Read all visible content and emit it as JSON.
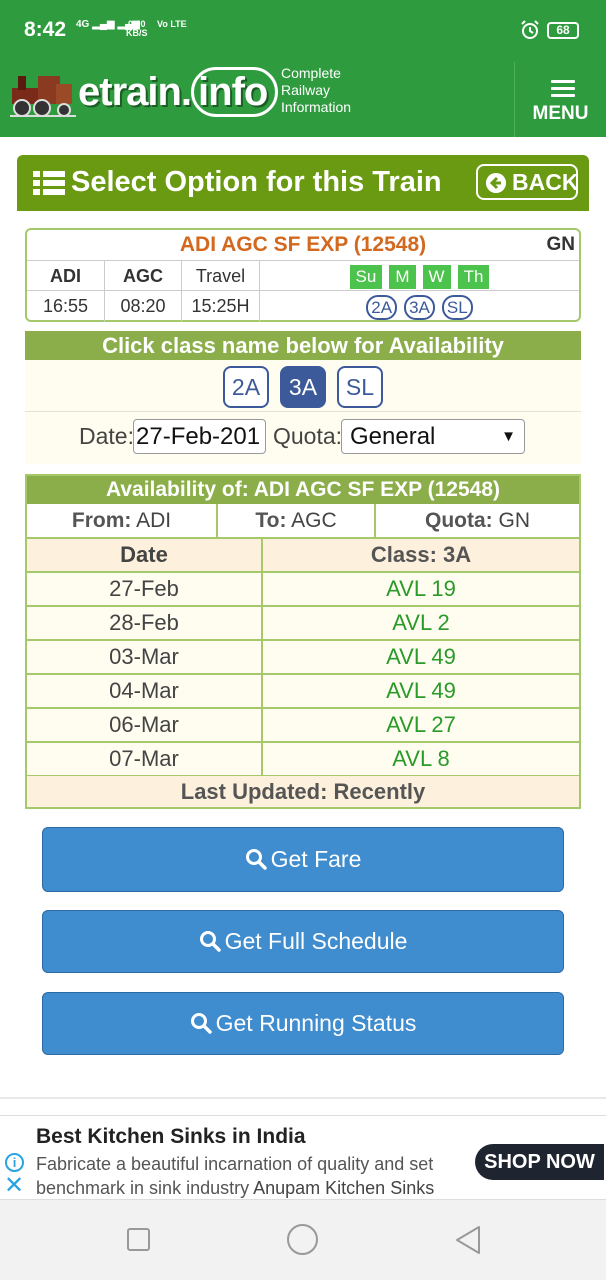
{
  "status_bar": {
    "time": "8:42",
    "network": "4G",
    "speed_value": "0.00",
    "speed_unit": "KB/S",
    "volte": "Vo LTE",
    "battery": "68"
  },
  "header": {
    "logo_part1": "etrain.",
    "logo_part2": "info",
    "tagline_1": "Complete",
    "tagline_2": "Railway",
    "tagline_3": "Information",
    "menu_label": "MENU"
  },
  "panel": {
    "title": "Select Option for this Train",
    "back_label": "BACK"
  },
  "train": {
    "name": "ADI AGC SF EXP (12548)",
    "quota_code": "GN",
    "from_code": "ADI",
    "to_code": "AGC",
    "travel_label": "Travel",
    "departure": "16:55",
    "arrival": "08:20",
    "travel_time": "15:25H",
    "days": [
      "Su",
      "M",
      "W",
      "Th"
    ],
    "classes": [
      "2A",
      "3A",
      "SL"
    ]
  },
  "class_select": {
    "heading": "Click class name below for Availability",
    "classes": [
      "2A",
      "3A",
      "SL"
    ],
    "active_class": "3A",
    "date_label": "Date:",
    "date_value": "27-Feb-201",
    "quota_label": "Quota:",
    "quota_value": "General"
  },
  "availability": {
    "heading": "Availability of: ADI AGC SF EXP (12548)",
    "from_label": "From:",
    "from_value": "ADI",
    "to_label": "To:",
    "to_value": "AGC",
    "quota_label": "Quota:",
    "quota_value": "GN",
    "col_date": "Date",
    "col_class": "Class: 3A",
    "rows": [
      {
        "date": "27-Feb",
        "status": "AVL 19"
      },
      {
        "date": "28-Feb",
        "status": "AVL 2"
      },
      {
        "date": "03-Mar",
        "status": "AVL 49"
      },
      {
        "date": "04-Mar",
        "status": "AVL 49"
      },
      {
        "date": "06-Mar",
        "status": "AVL 27"
      },
      {
        "date": "07-Mar",
        "status": "AVL 8"
      }
    ],
    "footer": "Last Updated: Recently"
  },
  "actions": {
    "fare": "Get Fare",
    "schedule": "Get Full Schedule",
    "running": "Get Running Status"
  },
  "ad": {
    "title": "Best Kitchen Sinks in India",
    "description": "Fabricate a beautiful incarnation of quality and set benchmark in sink industry",
    "advertiser": "Anupam Kitchen Sinks",
    "cta": "SHOP NOW"
  },
  "colors": {
    "brand_green": "#2e9b3e",
    "panel_olive": "#6a9a12",
    "button_blue": "#3f8ccf",
    "avail_green": "#2a9a2a",
    "train_name_orange": "#d2691e"
  },
  "icons": [
    "alarm-icon",
    "train-logo-icon",
    "hamburger-icon",
    "list-icon",
    "back-arrow-icon",
    "search-icon",
    "info-icon",
    "close-icon",
    "recent-apps-icon",
    "home-icon",
    "back-nav-icon"
  ]
}
